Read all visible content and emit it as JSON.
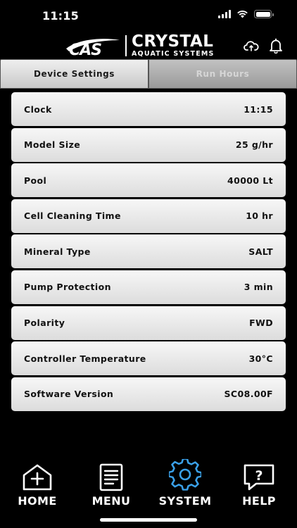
{
  "status_bar": {
    "time": "11:15"
  },
  "header": {
    "brand": "CRYSTAL",
    "brand_sub": "AQUATIC SYSTEMS",
    "logo_mark": "CAS"
  },
  "tabs": [
    {
      "label": "Device Settings",
      "active": true
    },
    {
      "label": "Run Hours",
      "active": false
    }
  ],
  "settings": [
    {
      "label": "Clock",
      "value": "11:15"
    },
    {
      "label": "Model Size",
      "value": "25 g/hr"
    },
    {
      "label": "Pool",
      "value": "40000 Lt"
    },
    {
      "label": "Cell Cleaning Time",
      "value": "10 hr"
    },
    {
      "label": "Mineral Type",
      "value": "SALT"
    },
    {
      "label": "Pump Protection",
      "value": "3 min"
    },
    {
      "label": "Polarity",
      "value": "FWD"
    },
    {
      "label": "Controller Temperature",
      "value": "30°C"
    },
    {
      "label": "Software Version",
      "value": "SC08.00F"
    }
  ],
  "nav": [
    {
      "label": "HOME",
      "icon": "home-add-icon"
    },
    {
      "label": "MENU",
      "icon": "menu-document-icon"
    },
    {
      "label": "SYSTEM",
      "icon": "gear-icon",
      "active": true
    },
    {
      "label": "HELP",
      "icon": "help-bubble-icon"
    }
  ],
  "colors": {
    "background": "#000000",
    "accent": "#3aa0e8",
    "row_bg": "#e9e9e9",
    "text_dark": "#111111"
  }
}
